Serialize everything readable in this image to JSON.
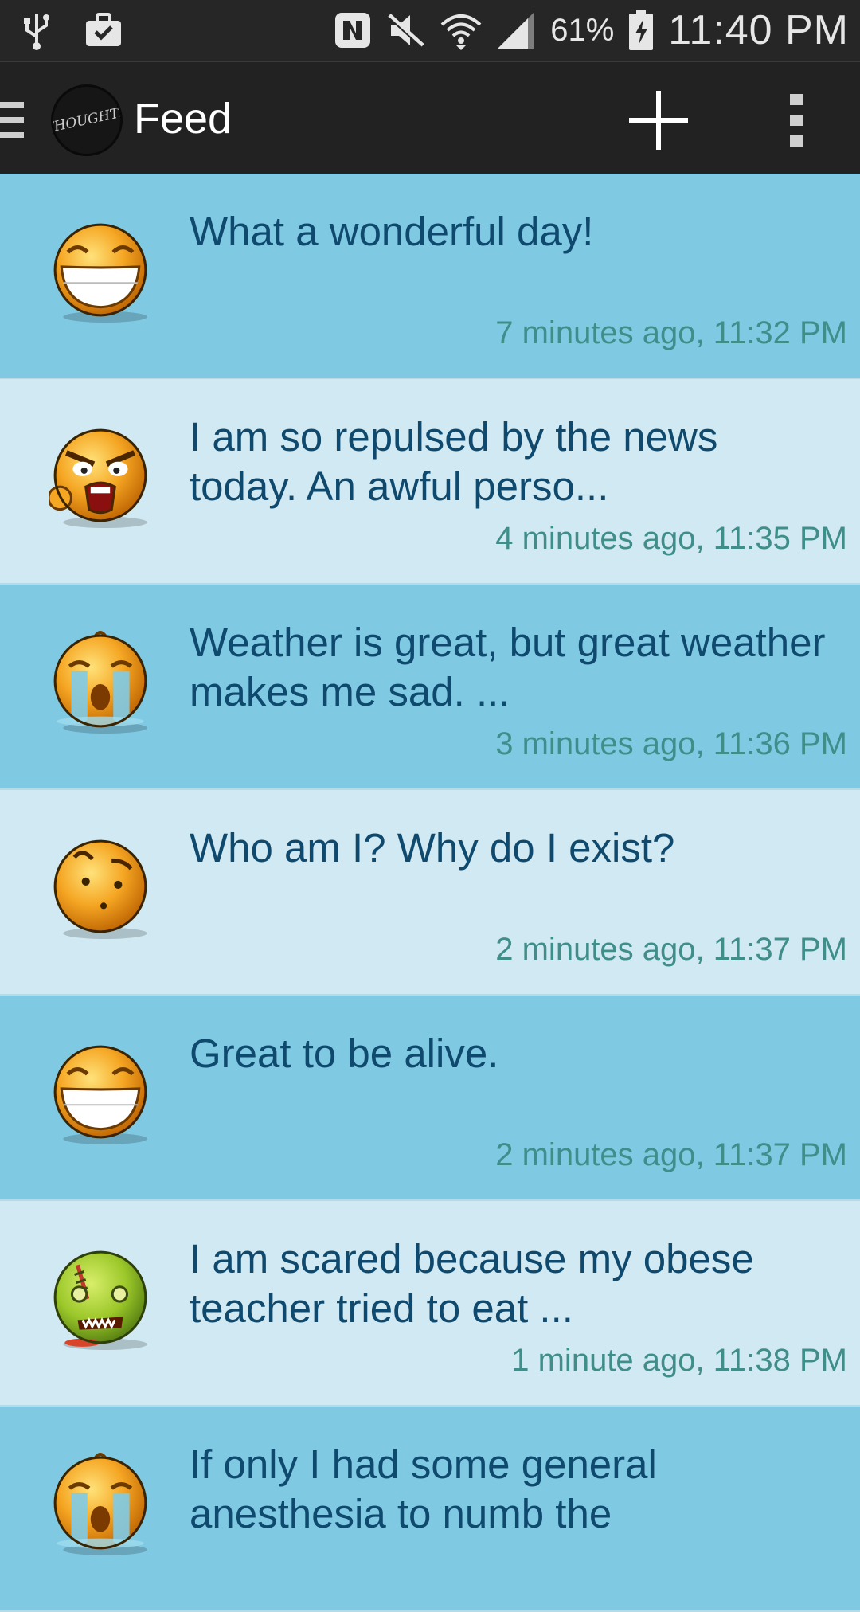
{
  "status_bar": {
    "battery": "61%",
    "time": "11:40 PM",
    "icons": [
      "usb-icon",
      "briefcase-icon",
      "nfc-icon",
      "mute-icon",
      "wifi-icon",
      "signal-icon",
      "battery-charging-icon"
    ]
  },
  "action_bar": {
    "title": "Feed",
    "logo_text": "THOUGHTS"
  },
  "feed": [
    {
      "emoji": "grin",
      "text": "What a wonderful day!",
      "time": "7 minutes ago, 11:32 PM"
    },
    {
      "emoji": "angry",
      "text": "I am so repulsed by the news today. An awful perso...",
      "time": "4 minutes ago, 11:35 PM"
    },
    {
      "emoji": "cry",
      "text": "Weather is great, but great weather makes me sad. ...",
      "time": "3 minutes ago, 11:36 PM"
    },
    {
      "emoji": "confused",
      "text": "Who am I? Why do I exist?",
      "time": "2 minutes ago, 11:37 PM"
    },
    {
      "emoji": "grin",
      "text": "Great to be alive.",
      "time": "2 minutes ago, 11:37 PM"
    },
    {
      "emoji": "zombie",
      "text": "I am scared because my obese teacher tried to eat ...",
      "time": "1 minute ago, 11:38 PM"
    },
    {
      "emoji": "cry",
      "text": "If only I had some general anesthesia to numb the",
      "time": ""
    }
  ],
  "colors": {
    "row_dark": "#7fc9e3",
    "row_light": "#d1e9f2",
    "message_text": "#0f4a6e",
    "time_text": "#3f8e8a"
  }
}
